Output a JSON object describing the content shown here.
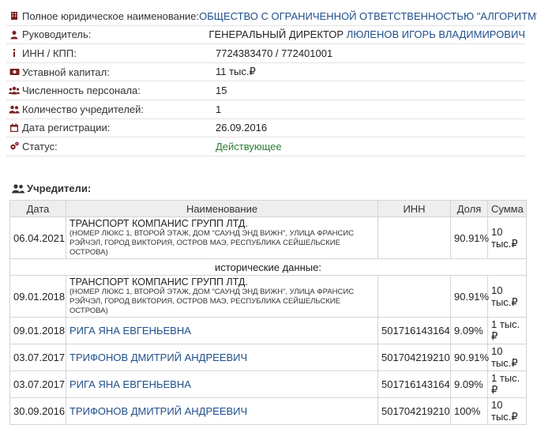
{
  "company": {
    "rows": [
      {
        "icon": "building-icon",
        "label": "Полное юридическое наименование:",
        "value": "ОБЩЕСТВО С ОГРАНИЧЕННОЙ ОТВЕТСТВЕННОСТЬЮ \"АЛГОРИТМ\"",
        "value_class": "link"
      },
      {
        "icon": "user-tie-icon",
        "label": "Руководитель:",
        "value_prefix": "ГЕНЕРАЛЬНЫЙ ДИРЕКТОР ",
        "value": "ЛЮЛЕНОВ ИГОРЬ ВЛАДИМИРОВИЧ",
        "value_class": "link"
      },
      {
        "icon": "info-icon",
        "label": "ИНН / КПП:",
        "value": "7724383470 / 772401001",
        "value_class": ""
      },
      {
        "icon": "money-icon",
        "label": "Уставной капитал:",
        "value": "11 тыс.₽",
        "value_class": ""
      },
      {
        "icon": "users-icon",
        "label": "Численность персонала:",
        "value": "15",
        "value_class": ""
      },
      {
        "icon": "user-group-icon",
        "label": "Количество учредителей:",
        "value": "1",
        "value_class": ""
      },
      {
        "icon": "calendar-icon",
        "label": "Дата регистрации:",
        "value": "26.09.2016",
        "value_class": ""
      },
      {
        "icon": "gears-icon",
        "label": "Статус:",
        "value": "Действующее",
        "value_class": "status-active"
      }
    ]
  },
  "founders": {
    "title": "Учредители:",
    "columns": [
      "Дата",
      "Наименование",
      "ИНН",
      "Доля",
      "Сумма"
    ],
    "current": [
      {
        "date": "06.04.2021",
        "name": "ТРАНСПОРТ КОМПАНИС ГРУПП ЛТД.",
        "address": "(НОМЕР ЛЮКС 1, ВТОРОЙ ЭТАЖ, ДОМ \"САУНД ЭНД ВИЖН\", УЛИЦА ФРАНСИС РЭЙЧЭЛ, ГОРОД ВИКТОРИЯ, ОСТРОВ МАЭ, РЕСПУБЛИКА СЕЙШЕЛЬСКИЕ ОСТРОВА)",
        "inn": "",
        "share": "90.91%",
        "sum": "10 тыс.₽"
      }
    ],
    "history_label": "исторические данные:",
    "history": [
      {
        "date": "09.01.2018",
        "name": "ТРАНСПОРТ КОМПАНИС ГРУПП ЛТД.",
        "address": "(НОМЕР ЛЮКС 1, ВТОРОЙ ЭТАЖ, ДОМ \"САУНД ЭНД ВИЖН\", УЛИЦА ФРАНСИС РЭЙЧЭЛ, ГОРОД ВИКТОРИЯ, ОСТРОВ МАЭ, РЕСПУБЛИКА СЕЙШЕЛЬСКИЕ ОСТРОВА)",
        "inn": "",
        "share": "90.91%",
        "sum": "10 тыс.₽"
      },
      {
        "date": "09.01.2018",
        "name": "РИГА ЯНА ЕВГЕНЬЕВНА",
        "inn": "501716143164",
        "share": "9.09%",
        "sum": "1 тыс.₽"
      },
      {
        "date": "03.07.2017",
        "name": "ТРИФОНОВ ДМИТРИЙ АНДРЕЕВИЧ",
        "inn": "501704219210",
        "share": "90.91%",
        "sum": "10 тыс.₽"
      },
      {
        "date": "03.07.2017",
        "name": "РИГА ЯНА ЕВГЕНЬЕВНА",
        "inn": "501716143164",
        "share": "9.09%",
        "sum": "1 тыс.₽"
      },
      {
        "date": "30.09.2016",
        "name": "ТРИФОНОВ ДМИТРИЙ АНДРЕЕВИЧ",
        "inn": "501704219210",
        "share": "100%",
        "sum": "10 тыс.₽"
      }
    ]
  }
}
